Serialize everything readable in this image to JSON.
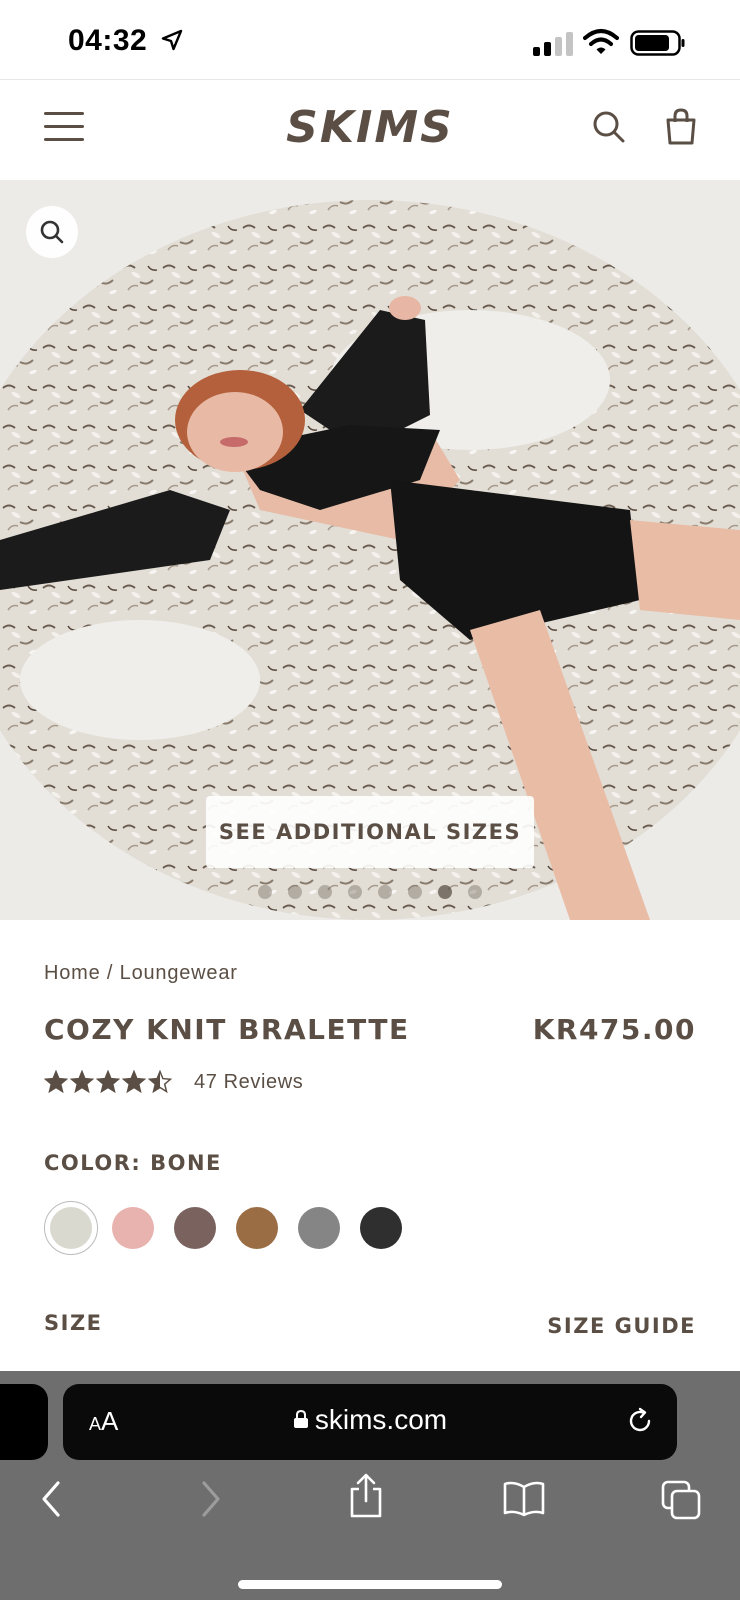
{
  "status_bar": {
    "time": "04:32"
  },
  "header": {
    "logo": "SKIMS"
  },
  "hero": {
    "cta_label": "SEE ADDITIONAL SIZES",
    "carousel": {
      "count": 8,
      "active_index": 6
    }
  },
  "breadcrumb": {
    "home": "Home",
    "separator": " / ",
    "category": "Loungewear"
  },
  "product": {
    "title": "COZY KNIT BRALETTE",
    "price": "KR475.00",
    "rating": 4.5,
    "reviews_label": "47 Reviews",
    "color_label": "COLOR: BONE",
    "colors": [
      {
        "name": "bone",
        "hex": "#d9d9cf",
        "selected": true
      },
      {
        "name": "pink",
        "hex": "#e8b2ae",
        "selected": false
      },
      {
        "name": "mauve",
        "hex": "#7a625f",
        "selected": false
      },
      {
        "name": "brown",
        "hex": "#9a6d45",
        "selected": false
      },
      {
        "name": "gray",
        "hex": "#858585",
        "selected": false
      },
      {
        "name": "black",
        "hex": "#2f2f2f",
        "selected": false
      }
    ],
    "size_label": "SIZE",
    "size_guide_label": "SIZE GUIDE"
  },
  "browser": {
    "aa_label_small": "A",
    "aa_label_large": "A",
    "url": "skims.com"
  },
  "theme": {
    "brand": "#5b4f45",
    "browser_chrome": "#6e6e6e"
  }
}
